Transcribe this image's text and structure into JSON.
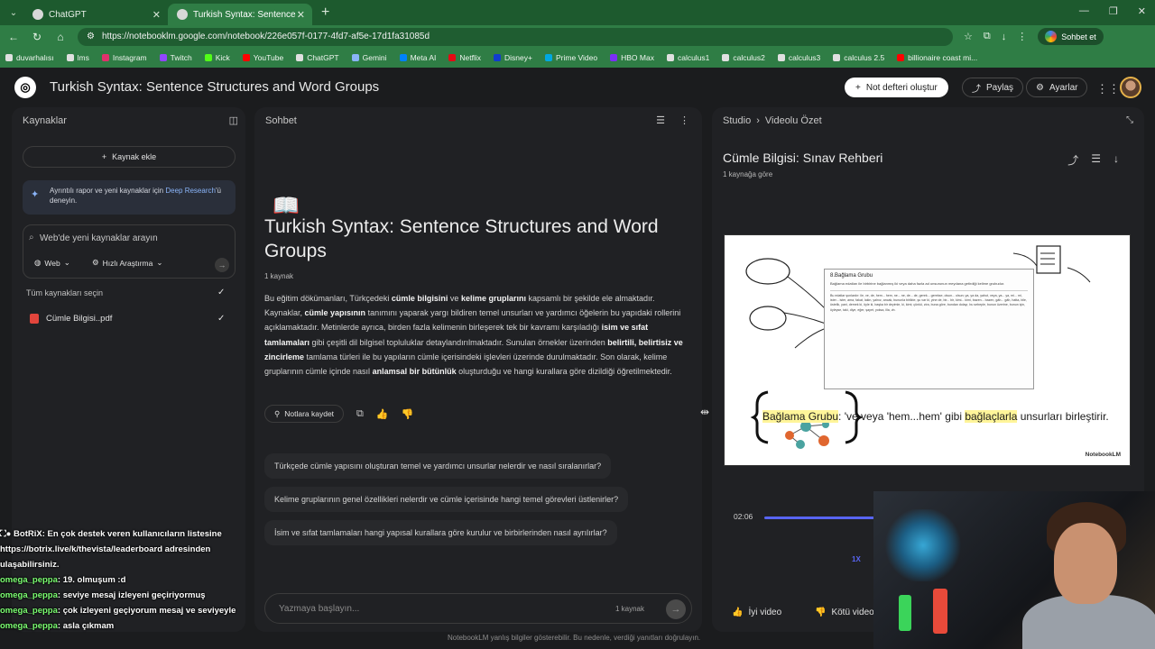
{
  "browser": {
    "tabs": [
      {
        "label": "ChatGPT",
        "active": false
      },
      {
        "label": "Turkish Syntax: Sentence Structure",
        "active": true
      }
    ],
    "url": "https://notebooklm.google.com/notebook/226e057f-0177-4fd7-af5e-17d1fa31085d",
    "profile_button": "Sohbet et",
    "bookmarks": [
      "duvarhalısı",
      "lms",
      "Instagram",
      "Twitch",
      "Kick",
      "YouTube",
      "ChatGPT",
      "Gemini",
      "Meta AI",
      "Netflix",
      "Disney+",
      "Prime Video",
      "HBO Max",
      "calculus1",
      "calculus2",
      "calculus3",
      "calculus 2.5",
      "billionaire coast mi..."
    ]
  },
  "header": {
    "title": "Turkish Syntax: Sentence Structures and Word Groups",
    "create_button": "Not defteri oluştur",
    "share_button": "Paylaş",
    "settings_button": "Ayarlar"
  },
  "sources": {
    "title": "Kaynaklar",
    "add_button": "Kaynak ekle",
    "tip_text": "Ayrıntılı rapor ve yeni kaynaklar için ",
    "tip_link": "Deep Research",
    "tip_suffix": "'ü deneyin.",
    "search_placeholder": "Web'de yeni kaynaklar arayın",
    "chip_web": "Web",
    "chip_fast": "Hızlı Araştırma",
    "select_all": "Tüm kaynakları seçin",
    "file": "Cümle Bilgisi..pdf"
  },
  "chat": {
    "title": "Sohbet",
    "heading": "Turkish Syntax: Sentence Structures and Word Groups",
    "source_count": "1 kaynak",
    "save_notes": "Notlara kaydet",
    "suggestions": [
      "Türkçede cümle yapısını oluşturan temel ve yardımcı unsurlar nelerdir ve nasıl sıralanırlar?",
      "Kelime gruplarının genel özellikleri nelerdir ve cümle içerisinde hangi temel görevleri üstlenirler?",
      "İsim ve sıfat tamlamaları hangi yapısal kurallara göre kurulur ve birbirlerinden nasıl ayrılırlar?"
    ],
    "input_placeholder": "Yazmaya başlayın...",
    "input_count": "1 kaynak",
    "disclaimer": "NotebookLM yanlış bilgiler gösterebilir. Bu nedenle, verdiği yanıtları doğrulayın."
  },
  "studio": {
    "crumb_root": "Studio",
    "crumb_current": "Videolu Özet",
    "video_title": "Cümle Bilgisi: Sınav Rehberi",
    "video_sub": "1 kaynağa göre",
    "slide_doc_title": "8.Bağlama Grubu",
    "slide_doc_text": "Bağlama edatları ile birbirine bağlanmış iki veya daha fazla ad unsurunun meydana getirdiği kelime grubudur.",
    "slide_doc_text2": "Bu edatlar şunlardır: ile, ve, de, hem... hem, ne... ne, de... de, gerek... gerekse, olsun... olsun; ya, ya da, yahut, veya, ya... ya, mi... mi, ister... ister, ama, fakat, lakin, yalnız, ancak, bununla birlikte, şu var ki, yine de, bir... bir, kimi... kimi, bazen... bazen, gâh... gâh, hatta, bile, üstelik, yani, demek ki, öyle ki, başka bir deyimle, ki, kimi; çünkü, zira, buna göre, bundan dolayı, bu sebeple, bunun üzerine, bunun için, öyleyse, taki, diye, eğer, şayet, yoksa, illa, vb.",
    "caption_term": "Bağlama Grubu",
    "caption_mid": ": 've veya 'hem...hem' gibi ",
    "caption_hl": "bağlaçlarla",
    "caption_end": " unsurları birleştirir.",
    "brand": "NotebookLM",
    "time": "02:06",
    "speed": "1X",
    "good_button": "İyi video",
    "bad_button": "Kötü video"
  },
  "stream_chat": [
    {
      "user": "BotRiX",
      "text": ": En çok destek veren kullanıcıların listesine https://botrix.live/k/thevista/leaderboard adresinden ulaşabilirsiniz."
    },
    {
      "user": "omega_peppa",
      "text": ": 19. olmuşum :d"
    },
    {
      "user": "omega_peppa",
      "text": ": seviye mesaj izleyeni geçiriyormuş"
    },
    {
      "user": "omega_peppa",
      "text": ": çok izleyeni geçiyorum mesaj ve seviyeyle"
    },
    {
      "user": "omega_peppa",
      "text": ": asla çıkmam"
    }
  ],
  "colors": {
    "tab_green": "#2f7d45",
    "accent_blue": "#5865f2",
    "highlight": "#fff59a"
  }
}
